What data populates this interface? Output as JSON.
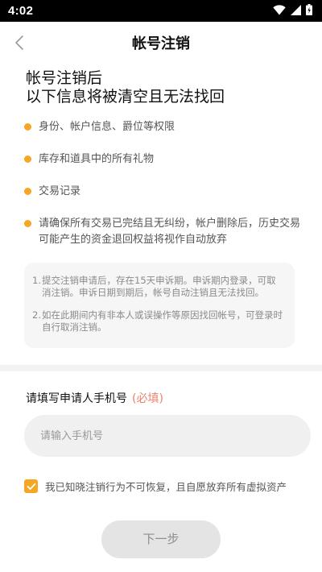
{
  "status_bar": {
    "time": "4:02",
    "icons": [
      "wifi-icon",
      "signal-icon",
      "battery-icon"
    ]
  },
  "nav": {
    "back_icon": "chevron-left-icon",
    "title": "帐号注销"
  },
  "headline": {
    "line1": "帐号注销后",
    "line2": "以下信息将被清空且无法找回"
  },
  "info_items": [
    "身份、帐户信息、爵位等权限",
    "库存和道具中的所有礼物",
    "交易记录",
    "请确保所有交易已完结且无纠纷，帐户删除后，历史交易可能产生的资金退回权益将视作自动放弃"
  ],
  "notes": [
    {
      "num": "1.",
      "text": "提交注销申请后，存在15天申诉期。申诉期内登录，可取消注销。申诉日期到期后，帐号自动注销且无法找回。"
    },
    {
      "num": "2.",
      "text": "如在此期间内有非本人或误操作等原因找回帐号，可登录时自行取消注销。"
    }
  ],
  "phone": {
    "label": "请填写申请人手机号",
    "required": "(必填)",
    "placeholder": "请输入手机号",
    "value": ""
  },
  "agreement": {
    "checked": true,
    "text": "我已知晓注销行为不可恢复，且自愿放弃所有虚拟资产"
  },
  "next_button": {
    "label": "下一步",
    "enabled": false
  },
  "colors": {
    "accent": "#F5A623",
    "required": "#E8836B",
    "button_disabled_bg": "#E4E4E4",
    "button_disabled_text": "#8E8E8E"
  }
}
